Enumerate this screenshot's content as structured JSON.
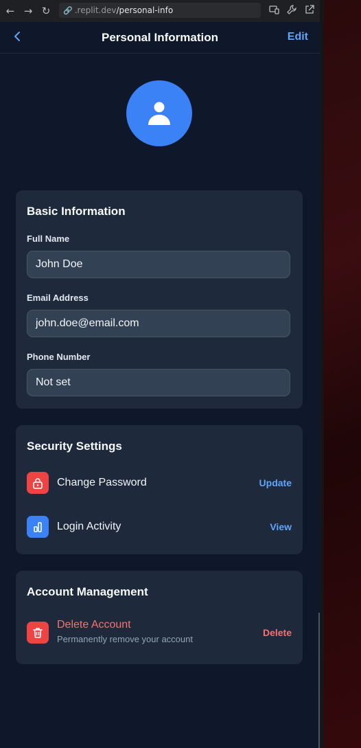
{
  "browser": {
    "url_host": ".replit.dev",
    "url_path": "/personal-info"
  },
  "header": {
    "title": "Personal Information",
    "edit_label": "Edit"
  },
  "basic": {
    "title": "Basic Information",
    "full_name_label": "Full Name",
    "full_name_value": "John Doe",
    "email_label": "Email Address",
    "email_value": "john.doe@email.com",
    "phone_label": "Phone Number",
    "phone_value": "Not set"
  },
  "security": {
    "title": "Security Settings",
    "items": [
      {
        "label": "Change Password",
        "action": "Update",
        "icon": "lock-icon",
        "color": "#ef4444"
      },
      {
        "label": "Login Activity",
        "action": "View",
        "icon": "activity-icon",
        "color": "#3b82f6"
      }
    ]
  },
  "account": {
    "title": "Account Management",
    "delete_title": "Delete Account",
    "delete_subtitle": "Permanently remove your account",
    "delete_action": "Delete",
    "icon": "trash-icon",
    "color": "#ef4444"
  },
  "colors": {
    "background": "#0f172a",
    "card": "#1e293b",
    "accent": "#3b82f6",
    "danger": "#ef4444"
  }
}
